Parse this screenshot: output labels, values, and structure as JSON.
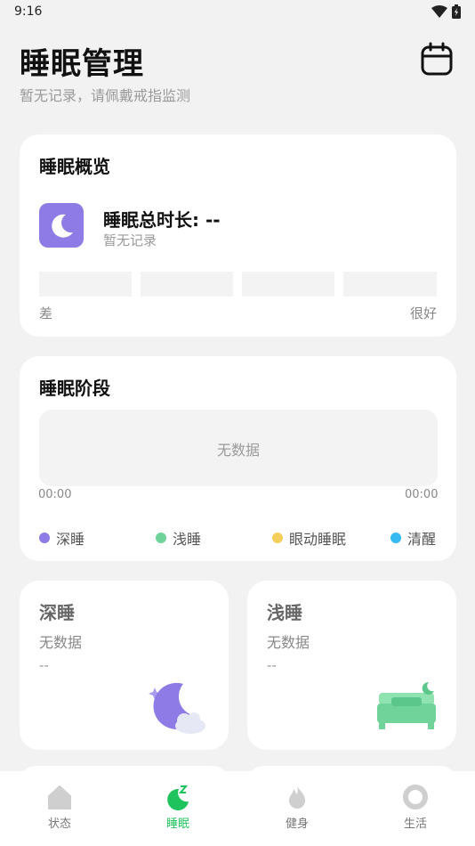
{
  "status_bar": {
    "time": "9:16"
  },
  "header": {
    "title": "睡眠管理",
    "subtitle": "暂无记录，请佩戴戒指监测",
    "calendar_icon": "calendar-icon"
  },
  "overview": {
    "title": "睡眠概览",
    "duration_label": "睡眠总时长: --",
    "duration_sub": "暂无记录",
    "scale_low": "差",
    "scale_high": "很好"
  },
  "stages": {
    "title": "睡眠阶段",
    "no_data": "无数据",
    "time_start": "00:00",
    "time_end": "00:00",
    "legend": [
      {
        "label": "深睡",
        "color": "#8e7be6"
      },
      {
        "label": "浅睡",
        "color": "#6fd39a"
      },
      {
        "label": "眼动睡眠",
        "color": "#f5cf5c"
      },
      {
        "label": "清醒",
        "color": "#35b9f0"
      }
    ]
  },
  "cards": {
    "deep": {
      "title": "深睡",
      "sub": "无数据",
      "value": "--"
    },
    "light": {
      "title": "浅睡",
      "sub": "无数据",
      "value": "--"
    }
  },
  "tabbar": {
    "active_color": "#1ec35d",
    "tabs": [
      {
        "label": "状态",
        "icon": "house-icon"
      },
      {
        "label": "睡眠",
        "icon": "sleep-icon"
      },
      {
        "label": "健身",
        "icon": "flame-icon"
      },
      {
        "label": "生活",
        "icon": "ring-icon"
      }
    ]
  }
}
